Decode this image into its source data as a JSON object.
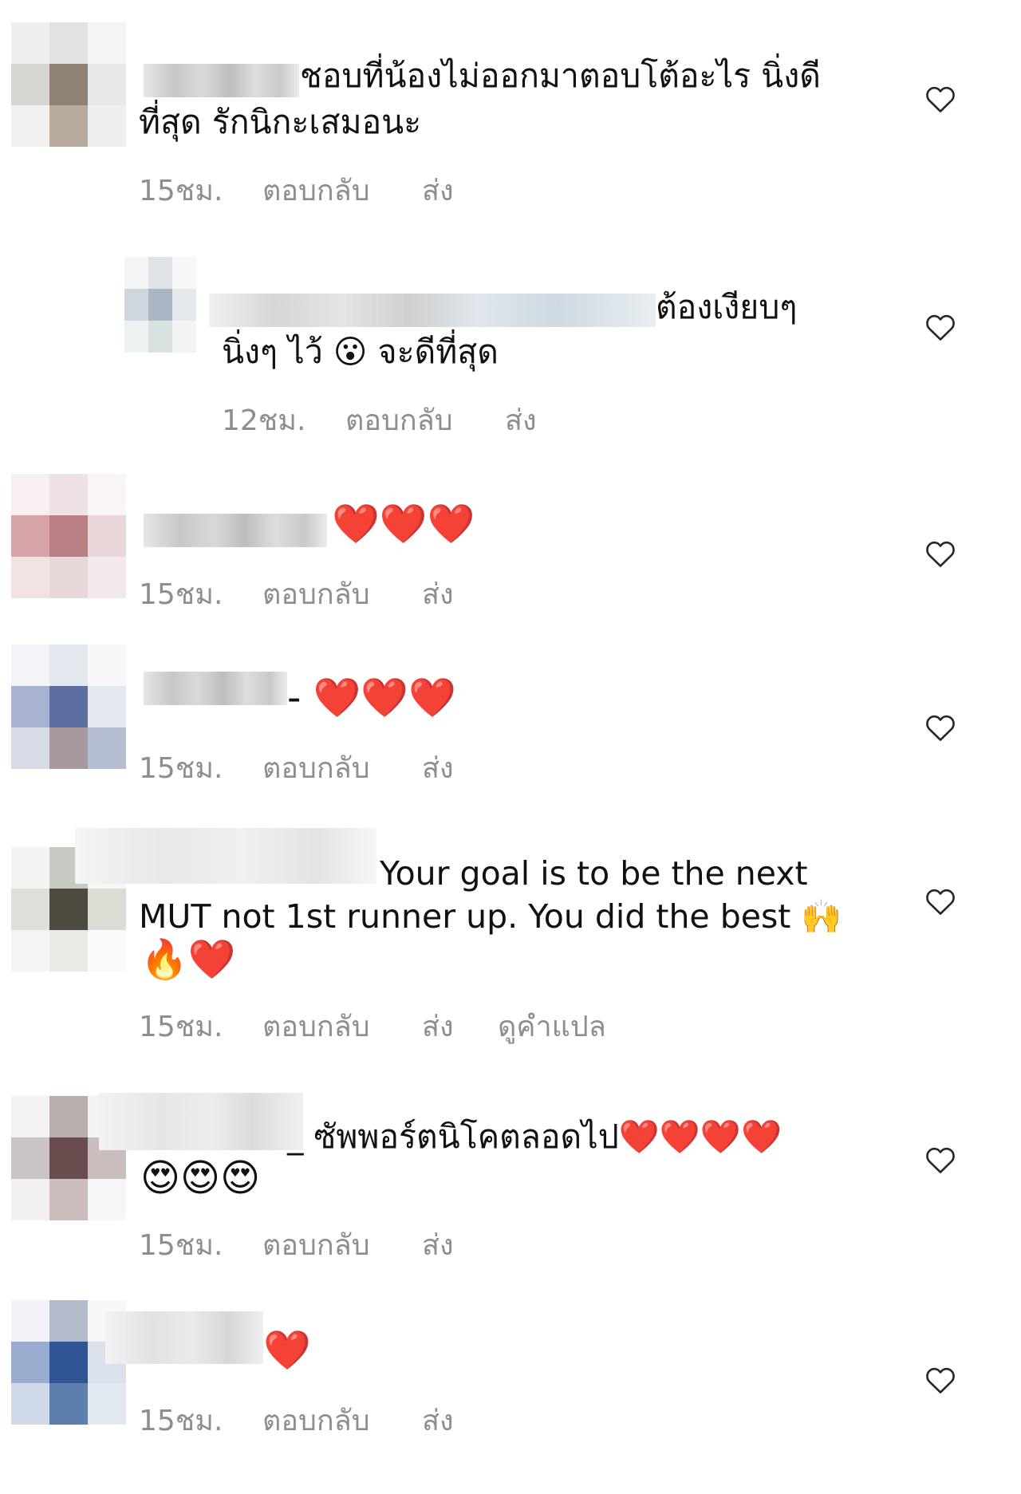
{
  "labels": {
    "reply": "ตอบกลับ",
    "send": "ส่ง",
    "see_translation": "ดูคำแปล"
  },
  "colors": {
    "meta_text": "#8e8e8e",
    "text": "#111111",
    "heart_icon_stroke": "#262626"
  },
  "comments": [
    {
      "line1": "ชอบที่น้องไม่ออกมาตอบโต้อะไร นิ่งดี",
      "line2": "ที่สุด รักนิกะเสมอนะ",
      "time": "15ชม.",
      "icon": "heart-outline-icon"
    },
    {
      "line1": "ต้องเงียบๆ",
      "line2": "นิ่งๆ ไว้ 😮 จะดีที่สุด",
      "time": "12ชม.",
      "icon": "heart-outline-icon"
    },
    {
      "line1": "❤️❤️❤️",
      "time": "15ชม.",
      "icon": "heart-outline-icon"
    },
    {
      "line1": "- ❤️❤️❤️",
      "time": "15ชม.",
      "icon": "heart-outline-icon"
    },
    {
      "line1": "Your goal is to be the next",
      "line2": "MUT not 1st runner up. You did the best 🙌",
      "line3": "🔥❤️",
      "time": "15ชม.",
      "icon": "heart-outline-icon"
    },
    {
      "line1": "_ ซัพพอร์ตนิโคตลอดไป❤️❤️❤️❤️",
      "line2": "😍😍😍",
      "time": "15ชม.",
      "icon": "heart-outline-icon"
    },
    {
      "line1": "❤️",
      "time": "15ชม.",
      "icon": "heart-outline-icon"
    }
  ]
}
